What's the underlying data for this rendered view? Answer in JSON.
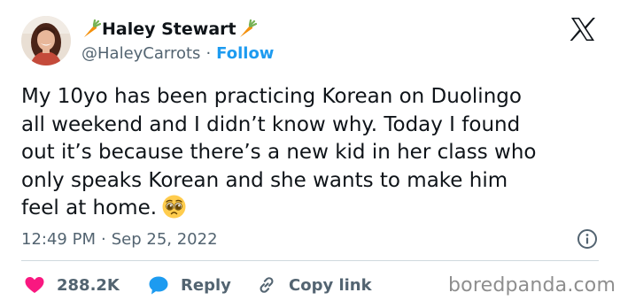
{
  "author": {
    "display_name": "Haley Stewart",
    "handle": "@HaleyCarrots",
    "separator": "·",
    "follow_label": "Follow"
  },
  "tweet": {
    "lines": [
      "My 10yo has been practicing Korean on Duolingo",
      "all weekend and I didn’t know why. Today I found",
      "out it’s because there’s a new kid in her class who",
      "only speaks Korean and she wants to make him",
      "feel at home."
    ],
    "emoji": "pleading-face"
  },
  "meta": {
    "time": "12:49 PM",
    "separator": "·",
    "date": "Sep 25, 2022"
  },
  "actions": {
    "likes_count": "288.2K",
    "reply_label": "Reply",
    "copy_link_label": "Copy link"
  },
  "watermark": "boredpanda.com",
  "icons": {
    "name_emoji": "carrot",
    "brand": "x-logo",
    "info": "info-icon",
    "like": "heart-icon",
    "reply": "speech-bubble-icon",
    "copy": "link-icon"
  },
  "colors": {
    "text": "#0f1419",
    "secondary": "#536471",
    "accent": "#1d9bf0",
    "like": "#f91880",
    "divider": "#cfd9de"
  }
}
